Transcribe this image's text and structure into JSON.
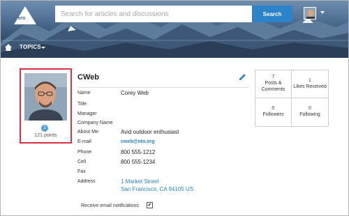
{
  "header": {
    "logo_text": "NTO",
    "search": {
      "placeholder": "Search for articles and discussions",
      "button_label": "Search"
    },
    "nav": {
      "topics_label": "TOPICS"
    }
  },
  "profile": {
    "name": "CWeb",
    "photo": {
      "badge": "2",
      "points": "121 points"
    },
    "fields": [
      {
        "label": "Name",
        "value": "Corey Web"
      },
      {
        "label": "Title",
        "value": ""
      },
      {
        "label": "Manager",
        "value": ""
      },
      {
        "label": "Company Name",
        "value": ""
      },
      {
        "label": "About Me",
        "value": "Avid outdoor enthusiast"
      },
      {
        "label": "E-mail",
        "value": "cweb@nto.org"
      },
      {
        "label": "Phone",
        "value": "800 555-1212"
      },
      {
        "label": "Cell",
        "value": "800 555-1234"
      },
      {
        "label": "Fax",
        "value": ""
      },
      {
        "label": "Address",
        "value": "1 Market Street",
        "value2": "San Francisco, CA 94105 US"
      }
    ],
    "email_notifications": {
      "label": "Receive email notifications",
      "checked": true
    }
  },
  "stats": [
    {
      "count": "7",
      "label": "Posts & Comments"
    },
    {
      "count": "1",
      "label": "Likes Received"
    },
    {
      "count": "0",
      "label": "Followers"
    },
    {
      "count": "0",
      "label": "Following"
    }
  ],
  "colors": {
    "accent": "#2b84c9",
    "highlight_border": "#d9333f"
  }
}
